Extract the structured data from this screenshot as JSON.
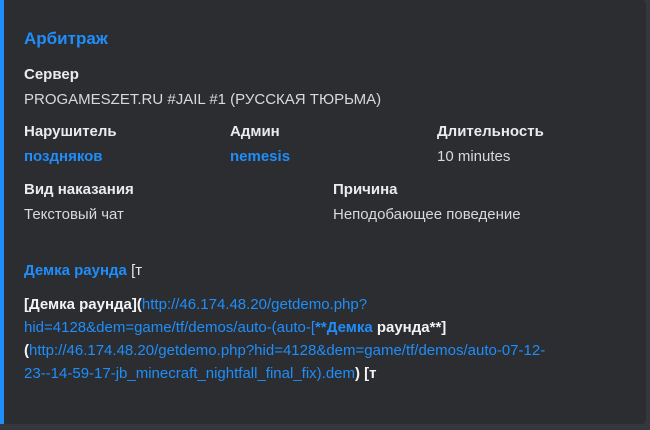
{
  "embed": {
    "accent_color": "#1f8efa",
    "title": "Арбитраж",
    "fields": {
      "server": {
        "name": "Сервер",
        "value": "PROGAMESZET.RU #JAIL #1 (РУССКАЯ ТЮРЬМА)"
      },
      "offender": {
        "name": "Нарушитель",
        "value": "поздняков"
      },
      "admin": {
        "name": "Админ",
        "value": "nemesis"
      },
      "duration": {
        "name": "Длительность",
        "value": "10 minutes"
      },
      "punishment": {
        "name": "Вид наказания",
        "value": "Текстовый чат"
      },
      "reason": {
        "name": "Причина",
        "value": "Неподобающее поведение"
      }
    },
    "description": {
      "head_link": "Демка раунда",
      "head_tail": " [т",
      "line1_bracket_open": "[Демка раунда](",
      "line1_url": "http://46.174.48.20/getdemo.php?",
      "line2_url": "hid=4128&dem=game/tf/demos/auto-(auto-[",
      "line2_bold_prefix": "**",
      "line2_bold_link": "Демка",
      "line2_bold_rest": " раунда**]",
      "line3_paren": "(",
      "line3_url": "http://46.174.48.20/getdemo.php?hid=4128&dem=game/tf/demos/auto-07-12-",
      "line4_url": "23--14-59-17-jb_minecraft_nightfall_final_fix).dem",
      "line4_tail": ") [т"
    }
  }
}
